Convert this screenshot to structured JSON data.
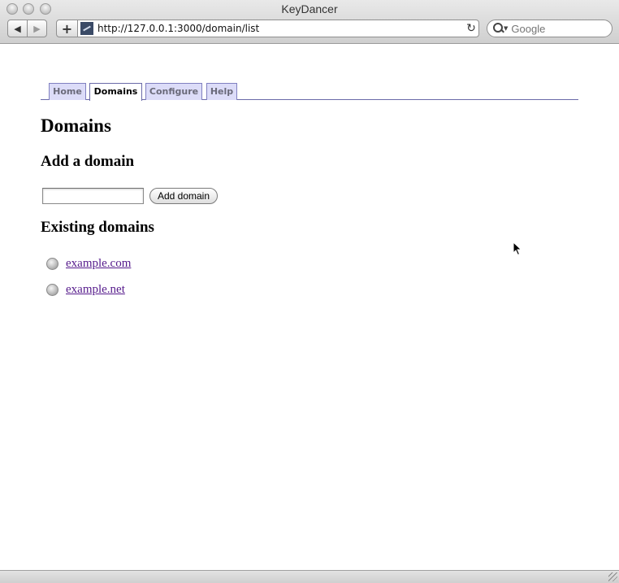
{
  "window": {
    "title": "KeyDancer"
  },
  "toolbar": {
    "back_icon": "◀",
    "forward_icon": "▶",
    "add_icon": "+",
    "url": "http://127.0.0.1:3000/domain/list",
    "reload_icon": "↻",
    "search_placeholder": "Google"
  },
  "tabs": [
    {
      "label": "Home"
    },
    {
      "label": "Domains"
    },
    {
      "label": "Configure"
    },
    {
      "label": "Help"
    }
  ],
  "page": {
    "title": "Domains",
    "add_heading": "Add a domain",
    "add_button": "Add domain",
    "input_value": "",
    "existing_heading": "Existing domains",
    "domains": [
      "example.com",
      "example.net"
    ]
  },
  "colors": {
    "tab_border": "#6a6aa8",
    "tab_bg": "#dcdcf8",
    "link": "#551a8b"
  }
}
